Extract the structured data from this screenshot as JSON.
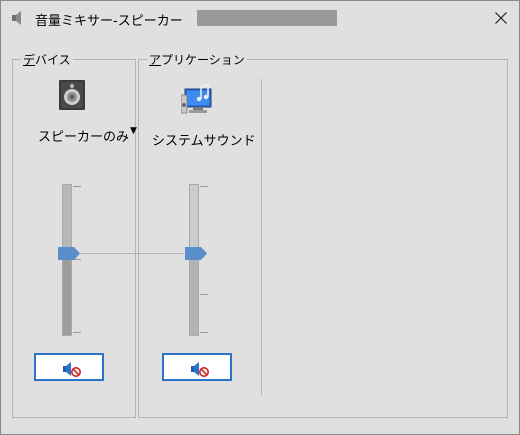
{
  "window": {
    "title": "音量ミキサー-スピーカー",
    "close_icon": "close-icon",
    "title_icon": "speaker-icon"
  },
  "device_group": {
    "label": "デバイス",
    "device_name": "スピーカーのみ",
    "device_icon": "speaker-device-icon",
    "volume_level": 0.55,
    "muted": true,
    "mute_icon": "speaker-muted-icon"
  },
  "apps_group": {
    "label": "アプリケーション",
    "apps": [
      {
        "name": "システムサウンド",
        "icon": "system-sounds-icon",
        "volume_level": 0.55,
        "muted": true,
        "mute_icon": "speaker-muted-icon"
      }
    ]
  },
  "colors": {
    "accent": "#2b73c8",
    "thumb": "#5b8fc9",
    "background": "#e0e0e0"
  }
}
